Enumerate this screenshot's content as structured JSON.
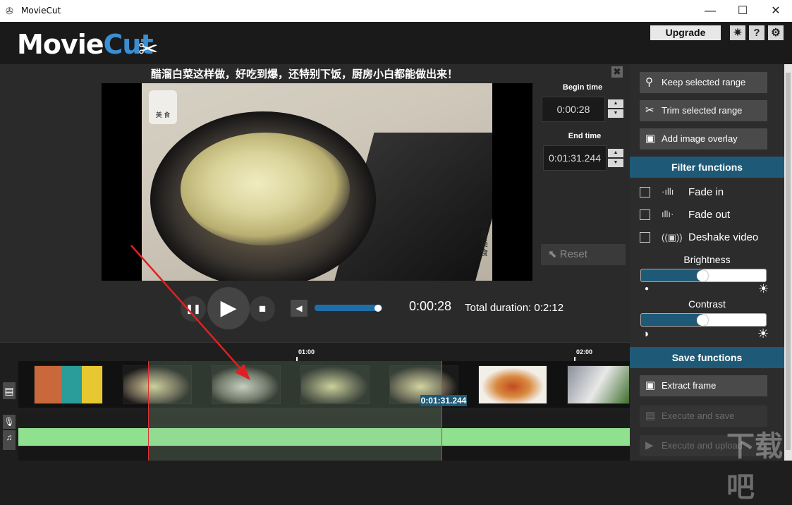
{
  "window": {
    "app_icon": "film-reel-icon",
    "title": "MovieCut",
    "minimize": "—",
    "maximize": "☐",
    "close": "✕"
  },
  "header": {
    "logo_movie": "Movie",
    "logo_cut": "Cut",
    "upgrade_label": "Upgrade",
    "buttons": [
      {
        "icon": "lightbulb-icon",
        "glyph": "✷"
      },
      {
        "icon": "help-icon",
        "glyph": "?"
      },
      {
        "icon": "gear-icon",
        "glyph": "⚙"
      }
    ]
  },
  "preview": {
    "video_title": "醋溜白菜这样做，好吃到爆，还特别下饭，厨房小白都能做出来！",
    "close_glyph": "✖",
    "watermark_chef": "美 食",
    "watermark_vertical": "小房美食",
    "begin_label": "Begin time",
    "begin_value": "0:00:28",
    "end_label": "End time",
    "end_value": "0:01:31.244",
    "spin_up": "▲",
    "spin_down": "▼",
    "reset_label": "Reset",
    "reset_glyph": "⬉"
  },
  "player": {
    "pause_glyph": "❚❚",
    "play_glyph": "▶",
    "stop_glyph": "■",
    "volume_glyph": "◀",
    "volume_level": 0.94,
    "current_time": "0:00:28",
    "total_duration": "Total duration: 0:2:12"
  },
  "actions": [
    {
      "label": "Keep selected range",
      "icon": "location-pin-icon",
      "glyph": "⚲"
    },
    {
      "label": "Trim selected range",
      "icon": "scissors-icon",
      "glyph": "✂"
    },
    {
      "label": "Add image overlay",
      "icon": "image-icon",
      "glyph": "▣"
    }
  ],
  "filters": {
    "heading": "Filter functions",
    "items": [
      {
        "label": "Fade in",
        "icon": "fade-in-icon",
        "glyph": "·ıllı"
      },
      {
        "label": "Fade out",
        "icon": "fade-out-icon",
        "glyph": "ıllı·"
      },
      {
        "label": "Deshake video",
        "icon": "deshake-icon",
        "glyph": "((▣))"
      }
    ],
    "brightness_label": "Brightness",
    "brightness_value": 0.49,
    "brightness_low_glyph": "●",
    "brightness_high_glyph": "☀",
    "contrast_label": "Contrast",
    "contrast_value": 0.49,
    "contrast_low_glyph": "◑",
    "contrast_high_glyph": "☀"
  },
  "save": {
    "heading": "Save functions",
    "items": [
      {
        "label": "Extract frame",
        "icon": "image-icon",
        "glyph": "▣",
        "enabled": true
      },
      {
        "label": "Execute and save",
        "icon": "floppy-icon",
        "glyph": "▤",
        "enabled": false
      },
      {
        "label": "Execute and upload",
        "icon": "youtube-icon",
        "glyph": "▶",
        "enabled": false
      }
    ]
  },
  "timeline": {
    "ticks": [
      "01:00",
      "02:00"
    ],
    "selection_end_label": "0:01:31.244",
    "side_buttons": [
      {
        "icon": "film-strip-icon",
        "glyph": "▤"
      },
      {
        "icon": "microphone-icon",
        "glyph": "🎙"
      },
      {
        "icon": "music-note-icon",
        "glyph": "♫"
      }
    ]
  },
  "watermark": "下载吧",
  "colors": {
    "accent": "#1e5a77",
    "logo_cut": "#3b8ed1",
    "audio_track": "#8fe08f",
    "selection_border": "#dd3333"
  }
}
